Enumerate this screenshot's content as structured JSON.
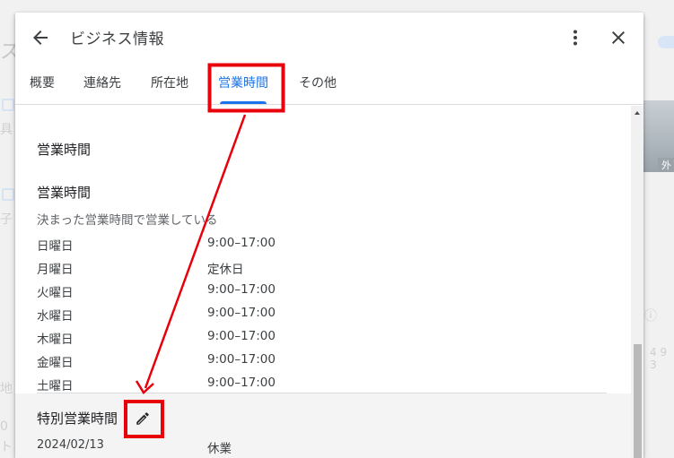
{
  "background": {
    "left_heading_fragment": "ス",
    "left_fragments": [
      "具",
      "子",
      "地",
      "0",
      "ト"
    ],
    "right_badge": "外",
    "right_digits": "4 9 3"
  },
  "dialog": {
    "title": "ビジネス情報",
    "back_icon": "arrow-left-icon",
    "more_icon": "more-vert-icon",
    "close_icon": "close-icon"
  },
  "tabs": [
    {
      "label": "概要",
      "active": false
    },
    {
      "label": "連絡先",
      "active": false
    },
    {
      "label": "所在地",
      "active": false
    },
    {
      "label": "営業時間",
      "active": true
    },
    {
      "label": "その他",
      "active": false
    }
  ],
  "content": {
    "section_title": "営業時間",
    "hours_title": "営業時間",
    "hours_mode": "決まった営業時間で営業している",
    "schedule": [
      {
        "day": "日曜日",
        "hours": "9:00–17:00"
      },
      {
        "day": "月曜日",
        "hours": "定休日"
      },
      {
        "day": "火曜日",
        "hours": "9:00–17:00"
      },
      {
        "day": "水曜日",
        "hours": "9:00–17:00"
      },
      {
        "day": "木曜日",
        "hours": "9:00–17:00"
      },
      {
        "day": "金曜日",
        "hours": "9:00–17:00"
      },
      {
        "day": "土曜日",
        "hours": "9:00–17:00"
      }
    ],
    "special_hours": {
      "title": "特別営業時間",
      "edit_icon": "pencil-icon",
      "entries": [
        {
          "date": "2024/02/13",
          "status": "休業"
        }
      ]
    }
  },
  "colors": {
    "accent": "#1a73e8",
    "annotation": "#e8000b",
    "divider": "#dadce0"
  }
}
